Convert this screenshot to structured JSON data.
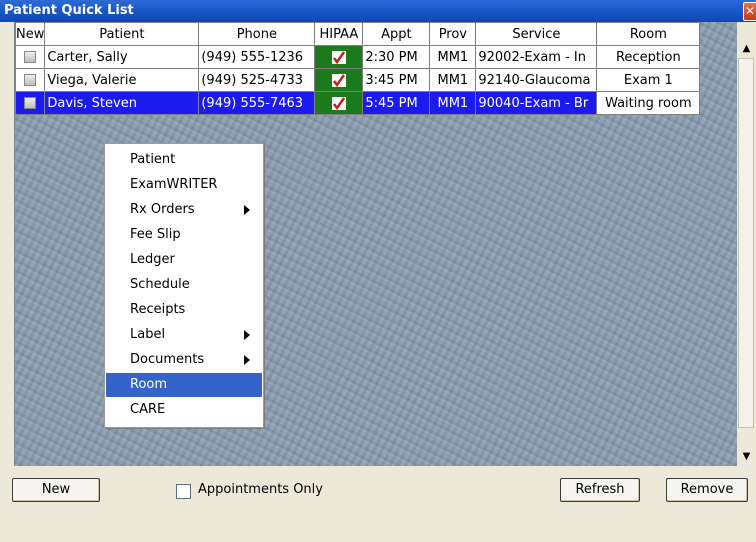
{
  "window": {
    "title": "Patient Quick List"
  },
  "columns": [
    "New",
    "Patient",
    "Phone",
    "HIPAA",
    "Appt",
    "Prov",
    "Service",
    "Room"
  ],
  "rows": [
    {
      "patient": "Carter, Sally",
      "phone": "(949) 555-1236",
      "appt": "2:30 PM",
      "prov": "MM1",
      "service": "92002-Exam - In",
      "room": "Reception",
      "selected": false
    },
    {
      "patient": "Viega, Valerie",
      "phone": "(949) 525-4733",
      "appt": "3:45 PM",
      "prov": "MM1",
      "service": "92140-Glaucoma",
      "room": "Exam 1",
      "selected": false
    },
    {
      "patient": "Davis, Steven",
      "phone": "(949) 555-7463",
      "appt": "5:45 PM",
      "prov": "MM1",
      "service": "90040-Exam - Br",
      "room": "Waiting room",
      "selected": true
    }
  ],
  "context_menu": {
    "items": [
      {
        "label": "Patient",
        "submenu": false
      },
      {
        "label": "ExamWRITER",
        "submenu": false
      },
      {
        "label": "Rx Orders",
        "submenu": true
      },
      {
        "label": "Fee Slip",
        "submenu": false
      },
      {
        "label": "Ledger",
        "submenu": false
      },
      {
        "label": "Schedule",
        "submenu": false
      },
      {
        "label": "Receipts",
        "submenu": false
      },
      {
        "label": "Label",
        "submenu": true
      },
      {
        "label": "Documents",
        "submenu": true
      },
      {
        "label": "Room",
        "submenu": false,
        "active": true
      },
      {
        "label": "CARE",
        "submenu": false
      }
    ]
  },
  "footer": {
    "new_label": "New",
    "appointments_only_label": "Appointments Only",
    "appointments_only_checked": false,
    "refresh_label": "Refresh",
    "remove_label": "Remove"
  },
  "colors": {
    "title_bar": "#1b58c8",
    "selected_row": "#1b1bf0",
    "hipaa_cell": "#1b7a1b",
    "menu_highlight": "#3464c8"
  },
  "icons": {
    "close": "close-icon",
    "hipaa_check": "check-icon",
    "scroll_up": "arrow-up-icon",
    "scroll_down": "arrow-down-icon",
    "submenu": "chevron-right-icon"
  }
}
